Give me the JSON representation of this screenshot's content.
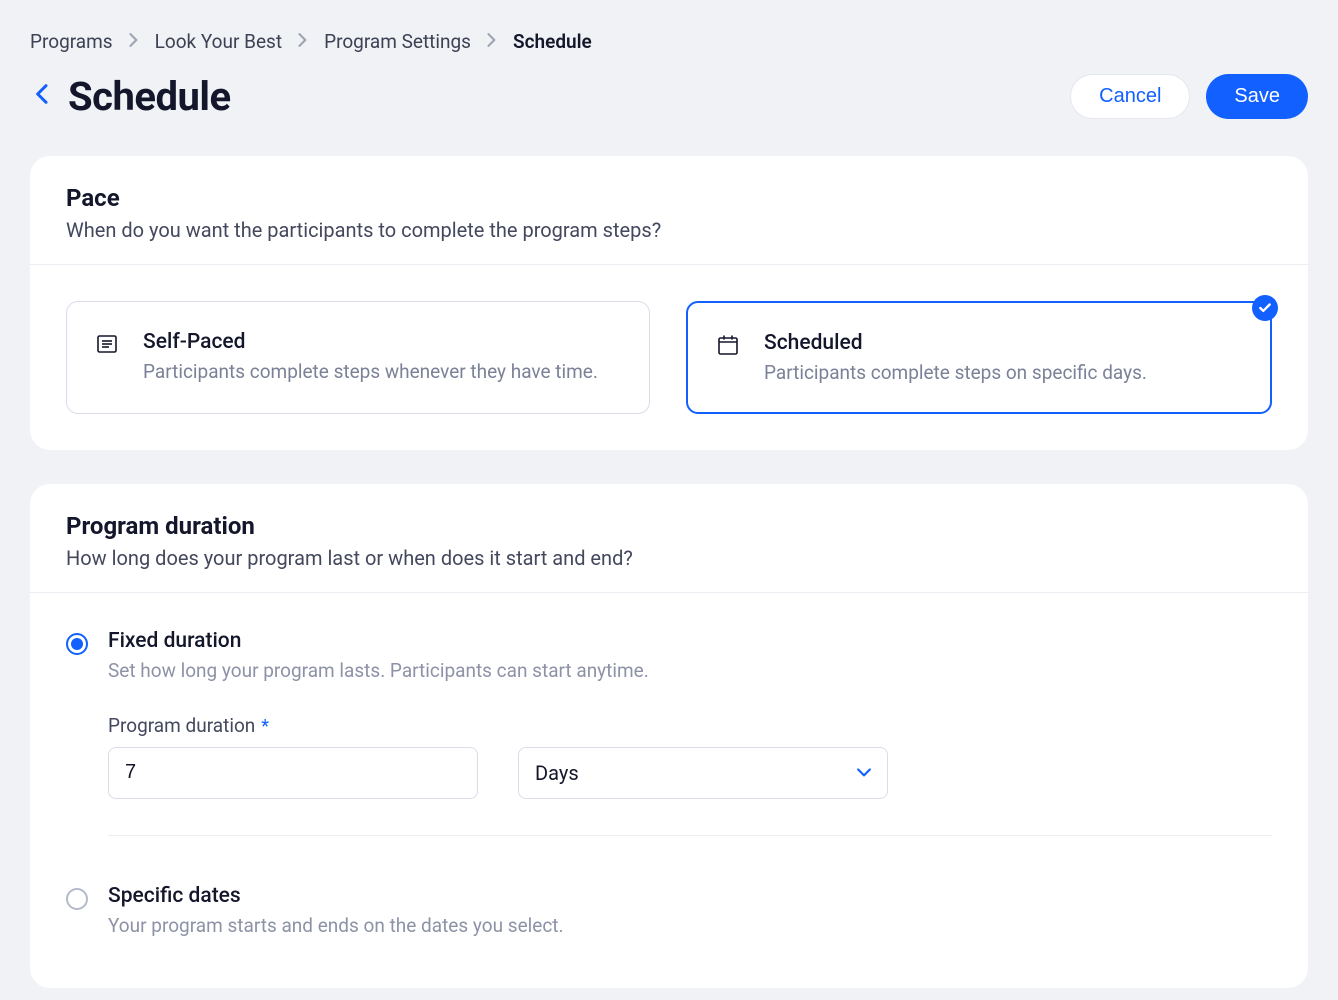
{
  "breadcrumb": [
    "Programs",
    "Look Your Best",
    "Program Settings",
    "Schedule"
  ],
  "page": {
    "title": "Schedule",
    "cancel_label": "Cancel",
    "save_label": "Save"
  },
  "pace": {
    "title": "Pace",
    "subtitle": "When do you want the participants to complete the program steps?",
    "options": [
      {
        "title": "Self-Paced",
        "subtitle": "Participants complete steps whenever they have time.",
        "selected": false
      },
      {
        "title": "Scheduled",
        "subtitle": "Participants complete steps on specific days.",
        "selected": true
      }
    ]
  },
  "duration": {
    "title": "Program duration",
    "subtitle": "How long does your program last or when does it start and end?",
    "fixed": {
      "title": "Fixed duration",
      "subtitle": "Set how long your program lasts. Participants can start anytime.",
      "selected": true,
      "field_label": "Program duration",
      "value": "7",
      "unit": "Days"
    },
    "specific": {
      "title": "Specific dates",
      "subtitle": "Your program starts and ends on the dates you select.",
      "selected": false
    }
  }
}
